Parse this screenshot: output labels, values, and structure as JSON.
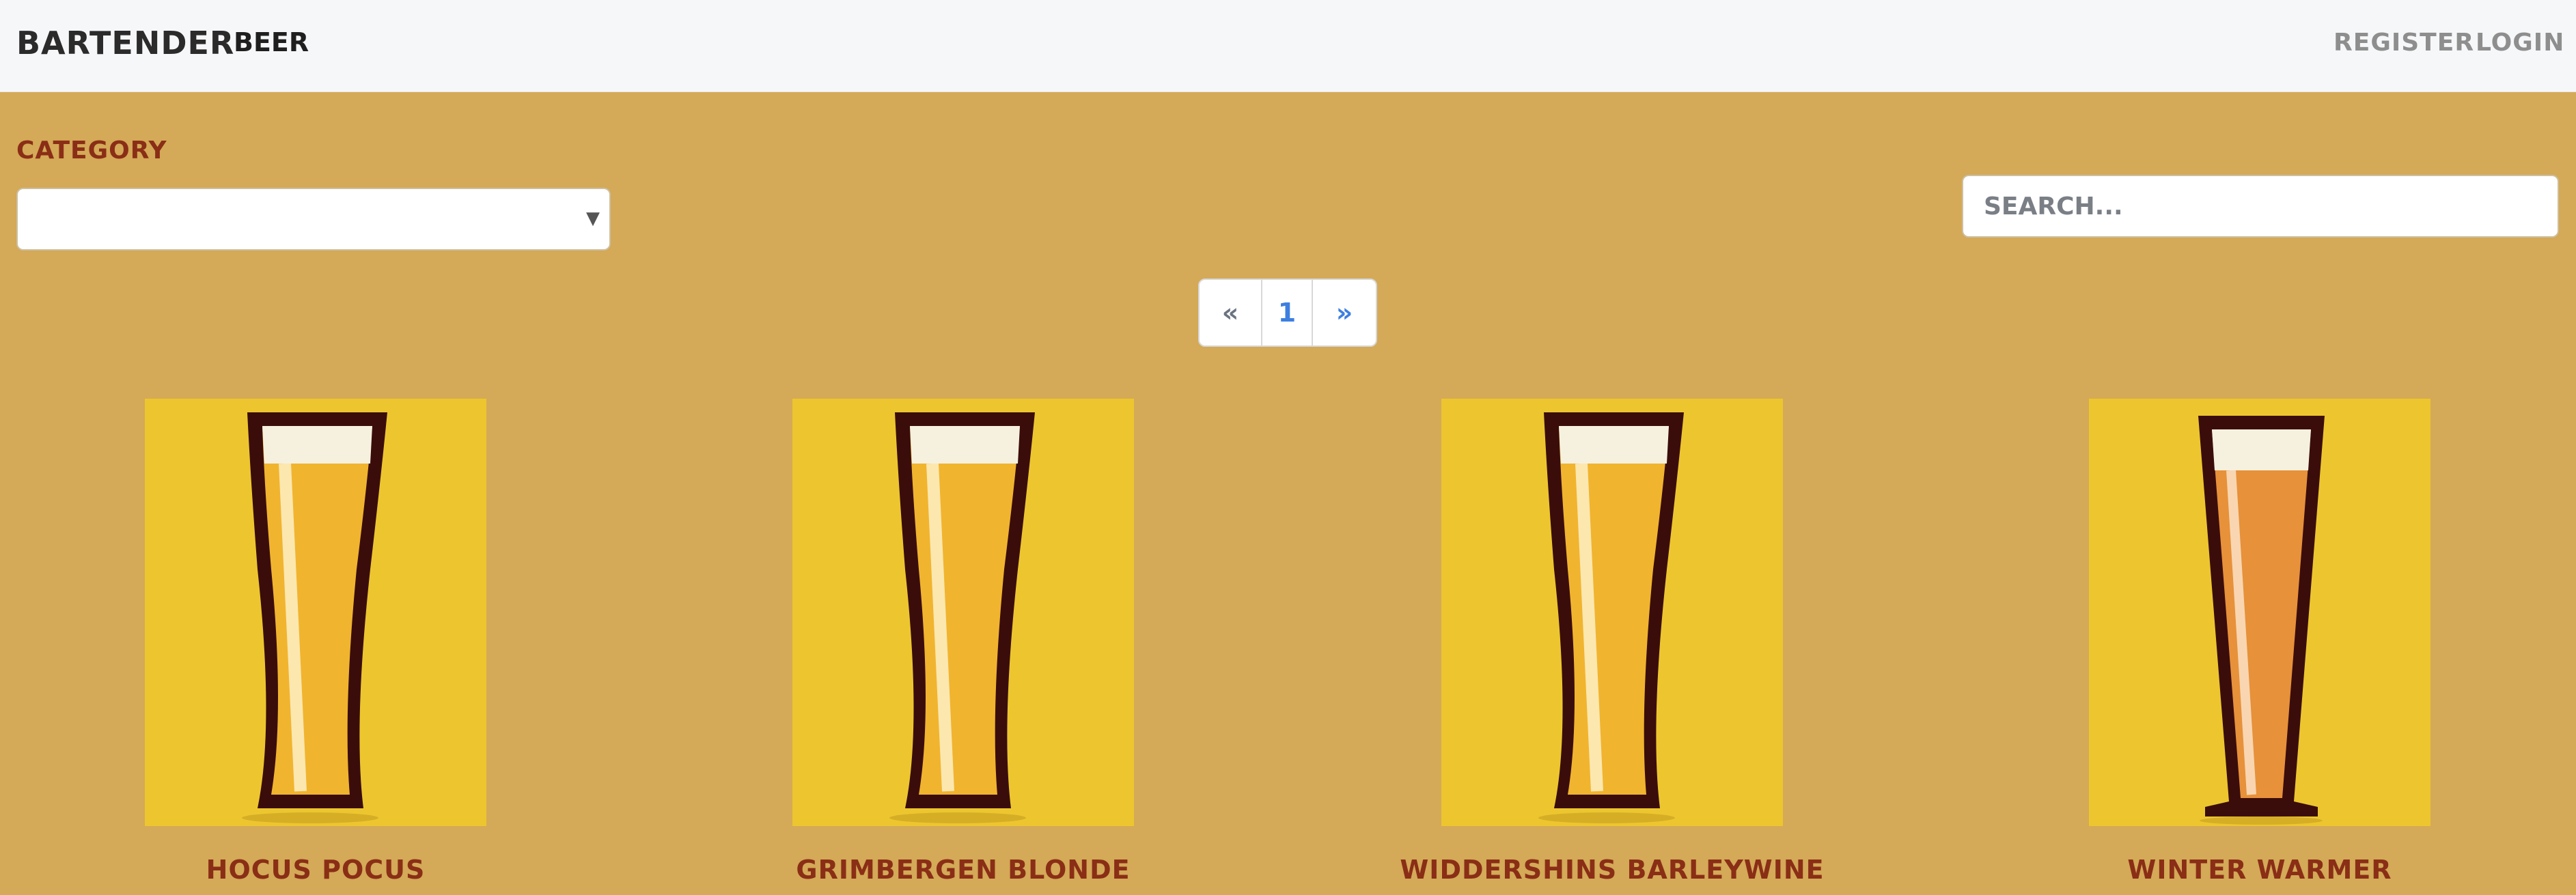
{
  "nav": {
    "brand": "BARTENDER",
    "beer": "BEER",
    "register": "REGISTER",
    "login": "LOGIN"
  },
  "filters": {
    "category_label": "CATEGORY",
    "category_value": "",
    "search_placeholder": "SEARCH..."
  },
  "pagination": {
    "prev": "«",
    "current": "1",
    "next": "»"
  },
  "beers": [
    {
      "name": "HOCUS POCUS",
      "glass": "weizen-glass-icon"
    },
    {
      "name": "GRIMBERGEN BLONDE",
      "glass": "weizen-glass-icon"
    },
    {
      "name": "WIDDERSHINS BARLEYWINE",
      "glass": "weizen-glass-icon"
    },
    {
      "name": "WINTER WARMER",
      "glass": "pilsner-glass-icon"
    }
  ],
  "colors": {
    "page_background": "#d4a957",
    "navbar_background": "#f6f7f9",
    "accent_text": "#8a2e16",
    "card_background": "#edc62f",
    "link_blue": "#3d7fe0"
  }
}
